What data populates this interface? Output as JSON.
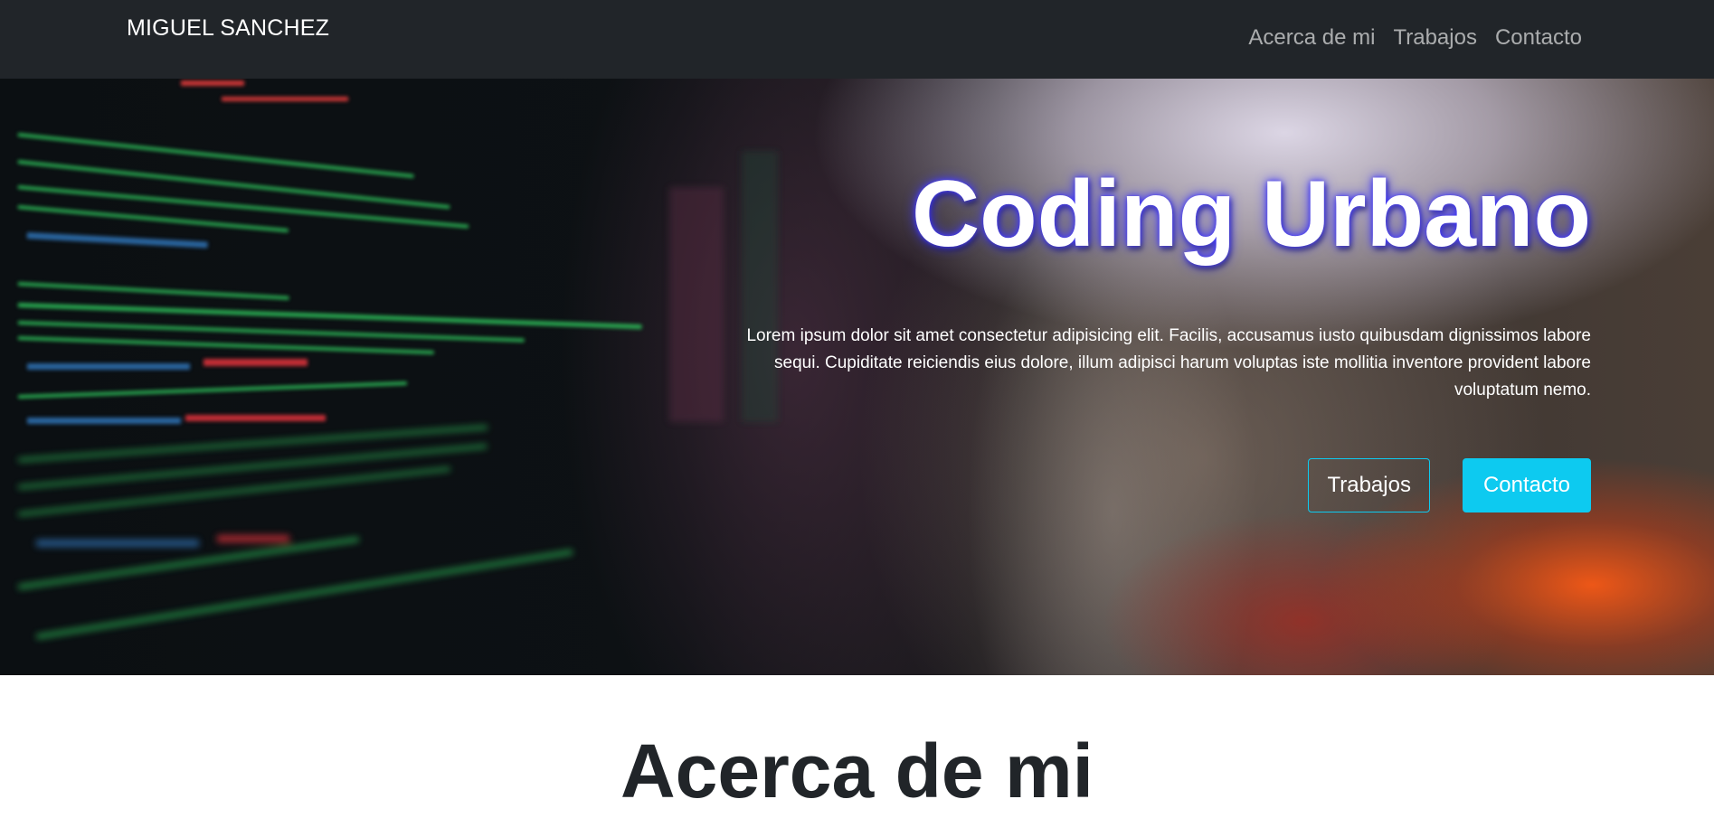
{
  "navbar": {
    "brand": "MIGUEL SANCHEZ",
    "links": [
      {
        "label": "Acerca de mi"
      },
      {
        "label": "Trabajos"
      },
      {
        "label": "Contacto"
      }
    ]
  },
  "hero": {
    "title": "Coding Urbano",
    "text": "Lorem ipsum dolor sit amet consectetur adipisicing elit. Facilis, accusamus iusto quibusdam dignissimos labore sequi. Cupiditate reiciendis eius dolore, illum adipisci harum voluptas iste mollitia inventore provident labore voluptatum nemo.",
    "buttons": {
      "primary_label": "Trabajos",
      "secondary_label": "Contacto"
    }
  },
  "about": {
    "heading": "Acerca de mi"
  },
  "colors": {
    "navbar_bg": "#212529",
    "accent": "#0dcaf0",
    "title_glow": "#3b32ff",
    "heading_text": "#212529"
  }
}
